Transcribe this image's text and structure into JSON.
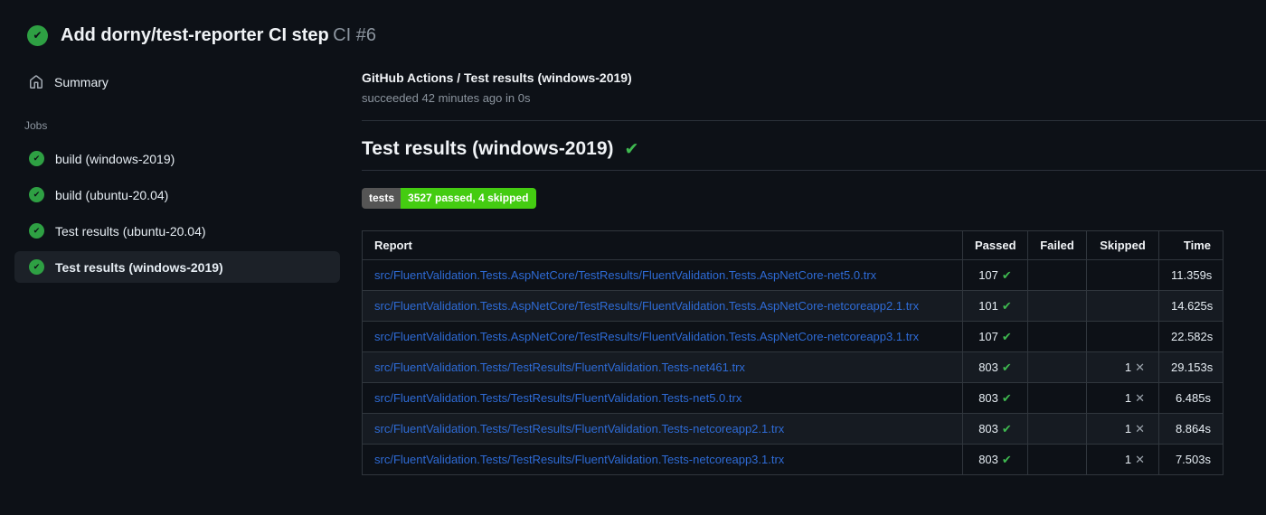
{
  "header": {
    "title": "Add dorny/test-reporter CI step",
    "run_number": "CI #6"
  },
  "sidebar": {
    "summary_label": "Summary",
    "jobs_label": "Jobs",
    "jobs": [
      {
        "label": "build (windows-2019)",
        "active": false
      },
      {
        "label": "build (ubuntu-20.04)",
        "active": false
      },
      {
        "label": "Test results (ubuntu-20.04)",
        "active": false
      },
      {
        "label": "Test results (windows-2019)",
        "active": true
      }
    ]
  },
  "main": {
    "breadcrumb_title": "GitHub Actions / Test results (windows-2019)",
    "status_line": "succeeded 42 minutes ago in 0s",
    "section_title": "Test results (windows-2019)",
    "badge": {
      "label": "tests",
      "value": "3527 passed, 4 skipped",
      "label_bg": "#555555",
      "value_bg": "#44cc11"
    }
  },
  "report_table": {
    "columns": [
      "Report",
      "Passed",
      "Failed",
      "Skipped",
      "Time"
    ],
    "rows": [
      {
        "report": "src/FluentValidation.Tests.AspNetCore/TestResults/FluentValidation.Tests.AspNetCore-net5.0.trx",
        "passed": "107",
        "failed": "",
        "skipped": "",
        "time": "11.359s"
      },
      {
        "report": "src/FluentValidation.Tests.AspNetCore/TestResults/FluentValidation.Tests.AspNetCore-netcoreapp2.1.trx",
        "passed": "101",
        "failed": "",
        "skipped": "",
        "time": "14.625s"
      },
      {
        "report": "src/FluentValidation.Tests.AspNetCore/TestResults/FluentValidation.Tests.AspNetCore-netcoreapp3.1.trx",
        "passed": "107",
        "failed": "",
        "skipped": "",
        "time": "22.582s"
      },
      {
        "report": "src/FluentValidation.Tests/TestResults/FluentValidation.Tests-net461.trx",
        "passed": "803",
        "failed": "",
        "skipped": "1",
        "time": "29.153s"
      },
      {
        "report": "src/FluentValidation.Tests/TestResults/FluentValidation.Tests-net5.0.trx",
        "passed": "803",
        "failed": "",
        "skipped": "1",
        "time": "6.485s"
      },
      {
        "report": "src/FluentValidation.Tests/TestResults/FluentValidation.Tests-netcoreapp2.1.trx",
        "passed": "803",
        "failed": "",
        "skipped": "1",
        "time": "8.864s"
      },
      {
        "report": "src/FluentValidation.Tests/TestResults/FluentValidation.Tests-netcoreapp3.1.trx",
        "passed": "803",
        "failed": "",
        "skipped": "1",
        "time": "7.503s"
      }
    ]
  },
  "icons": {
    "check": "✔",
    "cross": "✕"
  },
  "colors": {
    "background": "#0d1117",
    "success_green": "#2ea043",
    "check_green": "#3fb950",
    "badge_green": "#44cc11",
    "badge_gray": "#555555",
    "link_blue": "#2e6bd6",
    "border": "#30363d"
  }
}
